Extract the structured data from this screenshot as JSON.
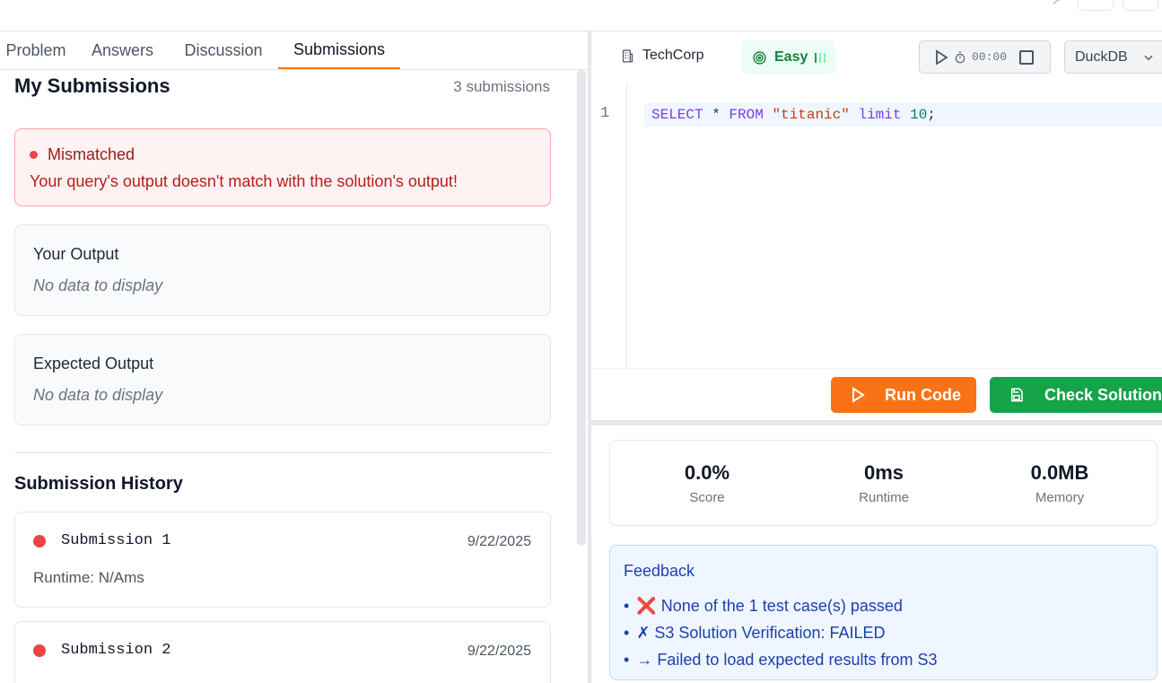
{
  "tabs": [
    "Problem",
    "Answers",
    "Discussion",
    "Submissions"
  ],
  "active_tab": "Submissions",
  "my_submissions": {
    "title": "My Submissions",
    "count": "3 submissions"
  },
  "alert": {
    "status": "Mismatched",
    "message": "Your query's output doesn't match with the solution's output!"
  },
  "your_output": {
    "title": "Your Output",
    "empty": "No data to display"
  },
  "expected_output": {
    "title": "Expected Output",
    "empty": "No data to display"
  },
  "history": {
    "title": "Submission History",
    "items": [
      {
        "name": "Submission 1",
        "date": "9/22/2025",
        "runtime": "Runtime: N/Ams"
      },
      {
        "name": "Submission 2",
        "date": "9/22/2025",
        "runtime": ""
      }
    ]
  },
  "toolbar": {
    "company": "TechCorp",
    "difficulty": "Easy",
    "timer": "00:00",
    "engine": "DuckDB"
  },
  "editor": {
    "line_number": "1",
    "code": {
      "select": "SELECT",
      "star": " * ",
      "from": "FROM",
      "table": "\"titanic\"",
      "limit": "limit",
      "num": "10",
      "semi": ";"
    }
  },
  "buttons": {
    "run": "Run Code",
    "check": "Check Solution"
  },
  "stats": [
    {
      "value": "0.0%",
      "label": "Score"
    },
    {
      "value": "0ms",
      "label": "Runtime"
    },
    {
      "value": "0.0MB",
      "label": "Memory"
    }
  ],
  "feedback": {
    "title": "Feedback",
    "items": [
      "❌ None of the 1 test case(s) passed",
      "✗ S3 Solution Verification: FAILED",
      "→ Failed to load expected results from S3"
    ]
  },
  "colors": {
    "accent": "#f97316",
    "success": "#16a34a",
    "error": "#ef4444",
    "info": "#1e40af"
  }
}
